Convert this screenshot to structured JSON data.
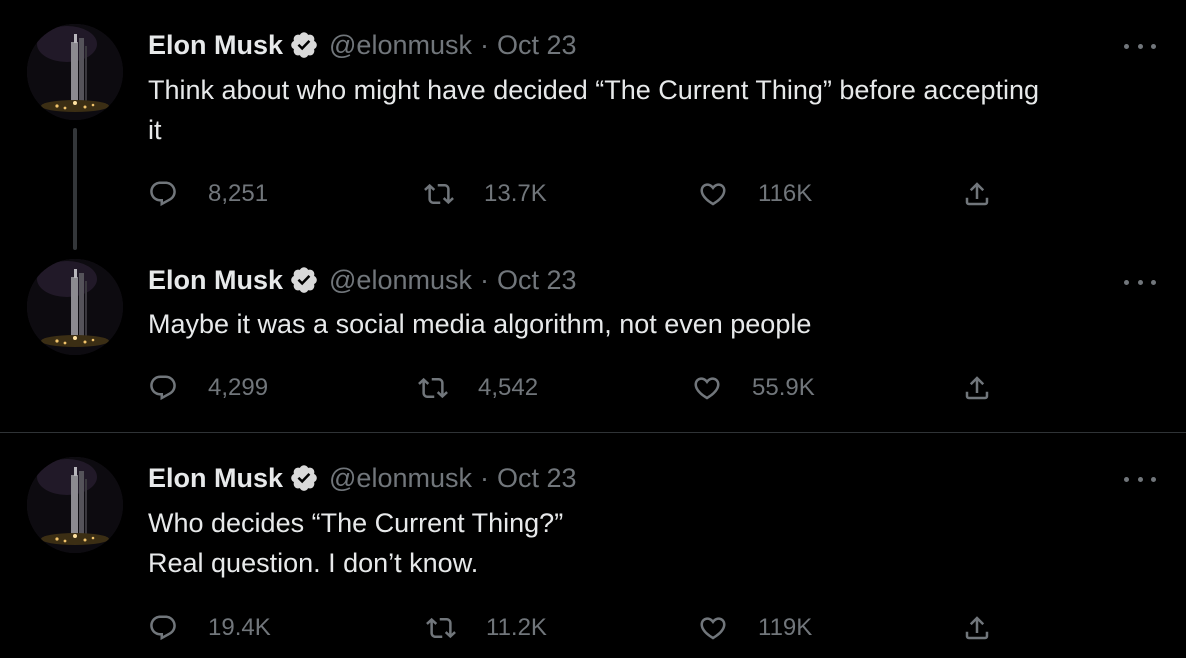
{
  "tweets": [
    {
      "author": "Elon Musk",
      "handle": "@elonmusk",
      "separator": "·",
      "date": "Oct 23",
      "text_lines": [
        "Think about who might have decided “The Current Thing” before accepting",
        "it"
      ],
      "replies": "8,251",
      "retweets": "13.7K",
      "likes": "116K"
    },
    {
      "author": "Elon Musk",
      "handle": "@elonmusk",
      "separator": "·",
      "date": "Oct 23",
      "text_lines": [
        "Maybe it was a social media algorithm, not even people"
      ],
      "replies": "4,299",
      "retweets": "4,542",
      "likes": "55.9K"
    },
    {
      "author": "Elon Musk",
      "handle": "@elonmusk",
      "separator": "·",
      "date": "Oct 23",
      "text_lines": [
        "Who decides “The Current Thing?”",
        "Real question. I don’t know."
      ],
      "replies": "19.4K",
      "retweets": "11.2K",
      "likes": "119K"
    }
  ],
  "icons": {
    "avatar": "avatar-starship-icon",
    "verified": "verified-badge-icon",
    "more": "more-options-icon",
    "reply": "reply-icon",
    "retweet": "retweet-icon",
    "like": "heart-icon",
    "share": "share-icon"
  },
  "colors": {
    "background": "#000000",
    "text": "#e7e9ea",
    "secondary": "#71767b",
    "divider": "#2f3336",
    "thread_line": "#333639"
  }
}
